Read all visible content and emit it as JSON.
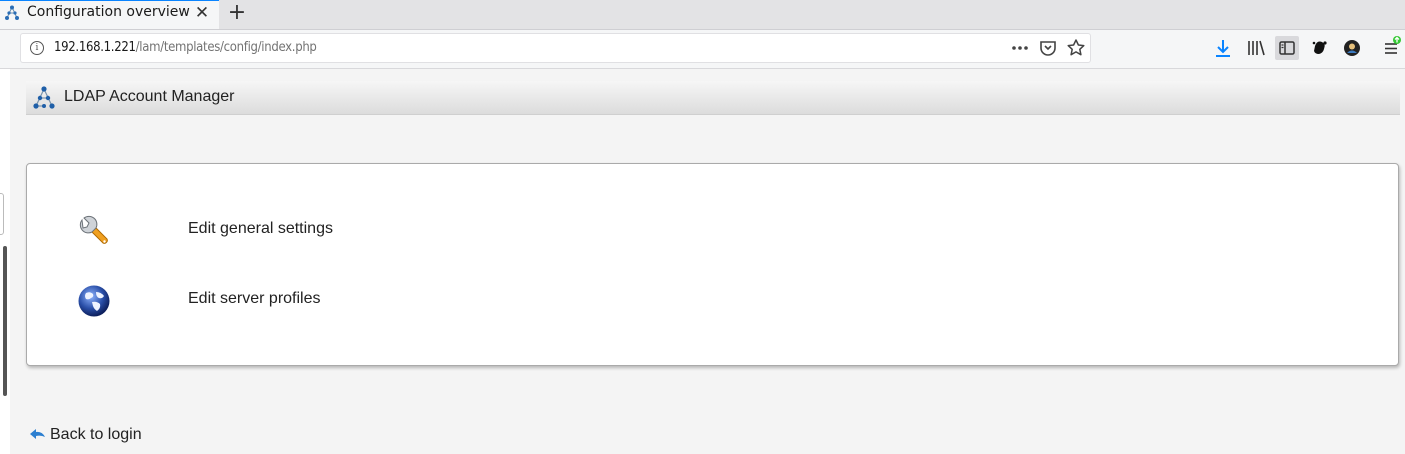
{
  "browser": {
    "tab_title": "Configuration overview",
    "url_host": "192.168.1.221",
    "url_path": "/lam/templates/config/index.php",
    "icons": [
      "tab-favicon",
      "close-icon",
      "plus-icon",
      "info-icon",
      "more-icon",
      "pocket-icon",
      "bookmark-star-icon",
      "download-icon",
      "library-icon",
      "sidebar-icon",
      "extension-icon",
      "account-avatar-icon",
      "menu-icon"
    ]
  },
  "header": {
    "title": "LDAP Account Manager"
  },
  "menu": {
    "items": [
      {
        "label": "Edit general settings",
        "icon": "wrench-icon"
      },
      {
        "label": "Edit server profiles",
        "icon": "globe-icon"
      }
    ]
  },
  "footer": {
    "back_label": "Back to login"
  },
  "colors": {
    "accent": "#0a84ff",
    "page_bg": "#f4f4f4",
    "panel_border": "#aaaaaa"
  }
}
